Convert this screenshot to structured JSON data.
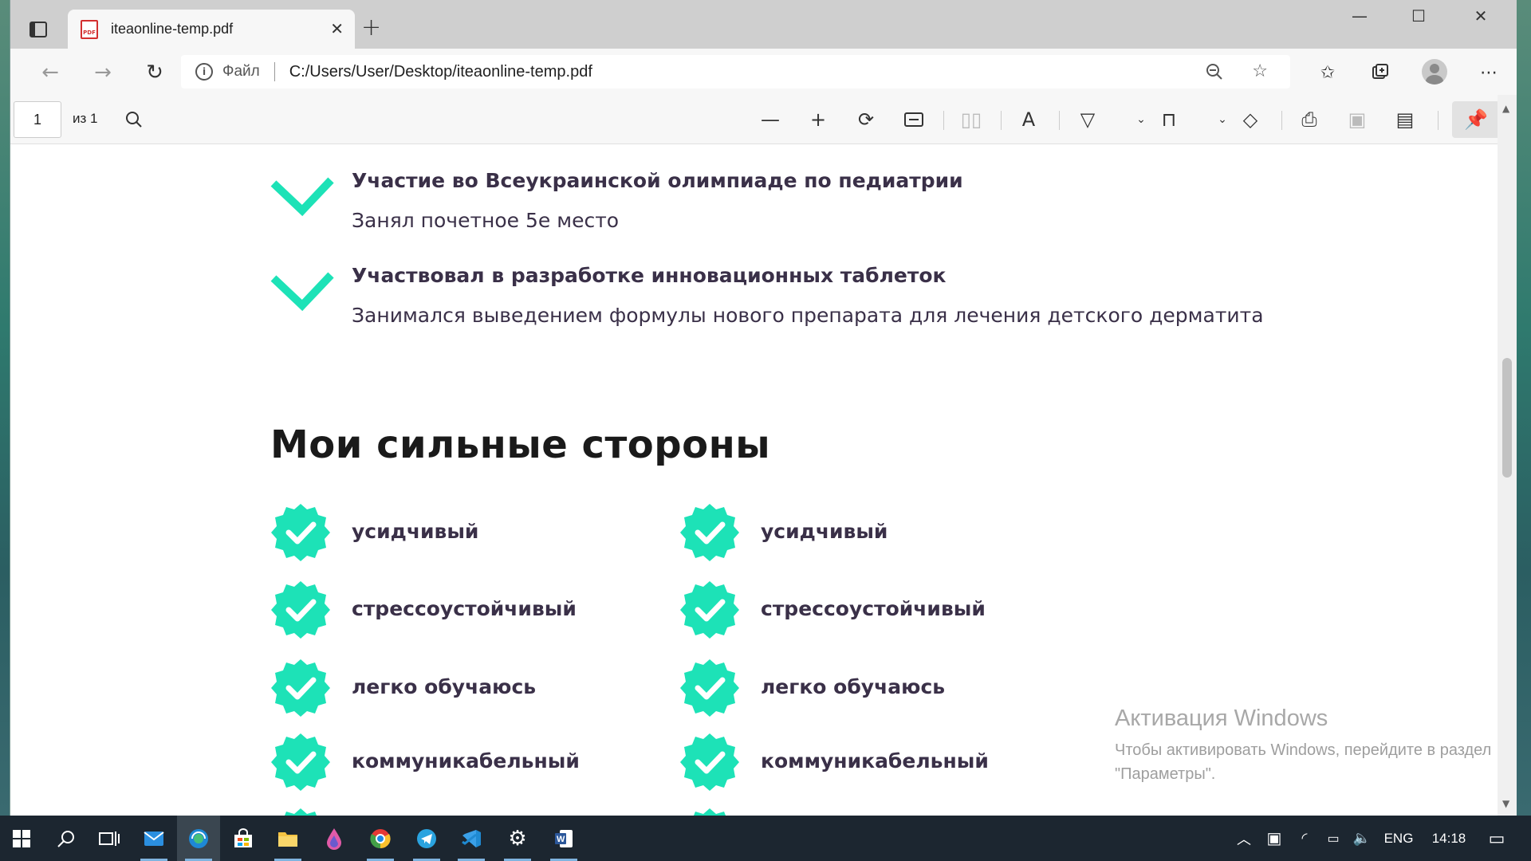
{
  "browser": {
    "tab_title": "iteaonline-temp.pdf",
    "favicon_label": "PDF",
    "address_scheme": "Файл",
    "address_url": "C:/Users/User/Desktop/iteaonline-temp.pdf"
  },
  "pdf_toolbar": {
    "page_number": "1",
    "page_count": "из 1"
  },
  "document": {
    "achievements": [
      {
        "title": "Участие во Всеукраинской олимпиаде по педиатрии",
        "description": "Занял почетное 5е место"
      },
      {
        "title": "Участвовал в разработке инновационных таблеток",
        "description": "Занимался выведением формулы нового препарата для лечения детского дерматита"
      }
    ],
    "section_title": "Мои сильные стороны",
    "strengths_left": [
      "усидчивый",
      "стрессоустойчивый",
      "легко обучаюсь",
      "коммуникабельный"
    ],
    "strengths_right": [
      "усидчивый",
      "стрессоустойчивый",
      "легко обучаюсь",
      "коммуникабельный"
    ],
    "accent_color": "#1de2b7"
  },
  "watermark": {
    "title": "Активация Windows",
    "text": "Чтобы активировать Windows, перейдите в раздел \"Параметры\"."
  },
  "taskbar": {
    "language": "ENG",
    "time": "14:18"
  }
}
